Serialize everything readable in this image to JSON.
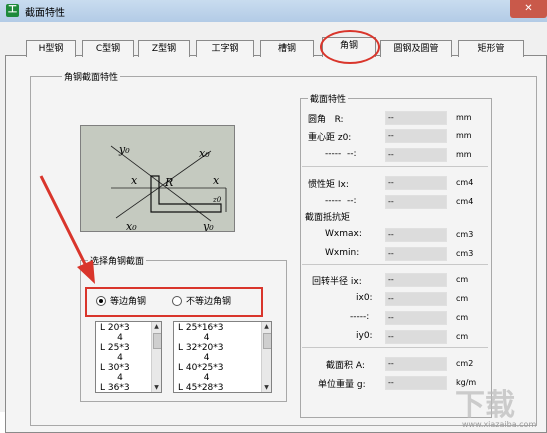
{
  "window": {
    "title": "截面特性",
    "app_icon": "工",
    "close_icon": "✕"
  },
  "tabs": [
    {
      "label": "H型钢"
    },
    {
      "label": "C型钢"
    },
    {
      "label": "Z型钢"
    },
    {
      "label": "工字钢"
    },
    {
      "label": "槽钢"
    },
    {
      "label": "角钢",
      "active": true
    },
    {
      "label": "圆钢及圆管"
    },
    {
      "label": "矩形管"
    }
  ],
  "angle_section": {
    "group_title": "角钢截面特性",
    "diagram_labels": {
      "y0_top": "y₀",
      "x0_top": "x₀",
      "x_left": "x",
      "x_right": "x",
      "r": "R",
      "z0": "z0",
      "x0_bottom": "x₀",
      "y0_bottom": "y₀"
    },
    "select_group_title": "选择角钢截面",
    "radio_equal": "等边角钢",
    "radio_unequal": "不等边角钢",
    "equal_list": [
      "L 20*3",
      "      4",
      "L 25*3",
      "      4",
      "L 30*3",
      "      4",
      "L 36*3"
    ],
    "unequal_list": [
      "L 25*16*3",
      "         4",
      "L 32*20*3",
      "         4",
      "L 40*25*3",
      "         4",
      "L 45*28*3"
    ]
  },
  "properties": {
    "group_title": "截面特性",
    "rows": [
      {
        "label": "圆角   R:",
        "value": "--",
        "unit": "mm"
      },
      {
        "label": "重心距 z0:",
        "value": "--",
        "unit": "mm"
      },
      {
        "label": "-----  --:",
        "value": "--",
        "unit": "mm"
      },
      {
        "label": "惯性矩 Ix:",
        "value": "--",
        "unit": "cm4"
      },
      {
        "label": "-----  --:",
        "value": "--",
        "unit": "cm4"
      },
      {
        "label": "Wxmax:",
        "value": "--",
        "unit": "cm3"
      },
      {
        "label": "Wxmin:",
        "value": "--",
        "unit": "cm3"
      },
      {
        "label": "回转半径 ix:",
        "value": "--",
        "unit": "cm"
      },
      {
        "label": "ix0:",
        "value": "--",
        "unit": "cm"
      },
      {
        "label": "-----:",
        "value": "--",
        "unit": "cm"
      },
      {
        "label": "iy0:",
        "value": "--",
        "unit": "cm"
      },
      {
        "label": "截面积 A:",
        "value": "--",
        "unit": "cm2"
      },
      {
        "label": "单位重量 g:",
        "value": "--",
        "unit": "kg/m"
      }
    ],
    "modulus_title": "截面抵抗矩"
  },
  "watermark": {
    "logo": "下载",
    "url": "www.xiazaiba.com"
  },
  "colors": {
    "highlight": "#d9352b",
    "titlebar": "#c9dcef",
    "field": "#dcdcdc"
  }
}
